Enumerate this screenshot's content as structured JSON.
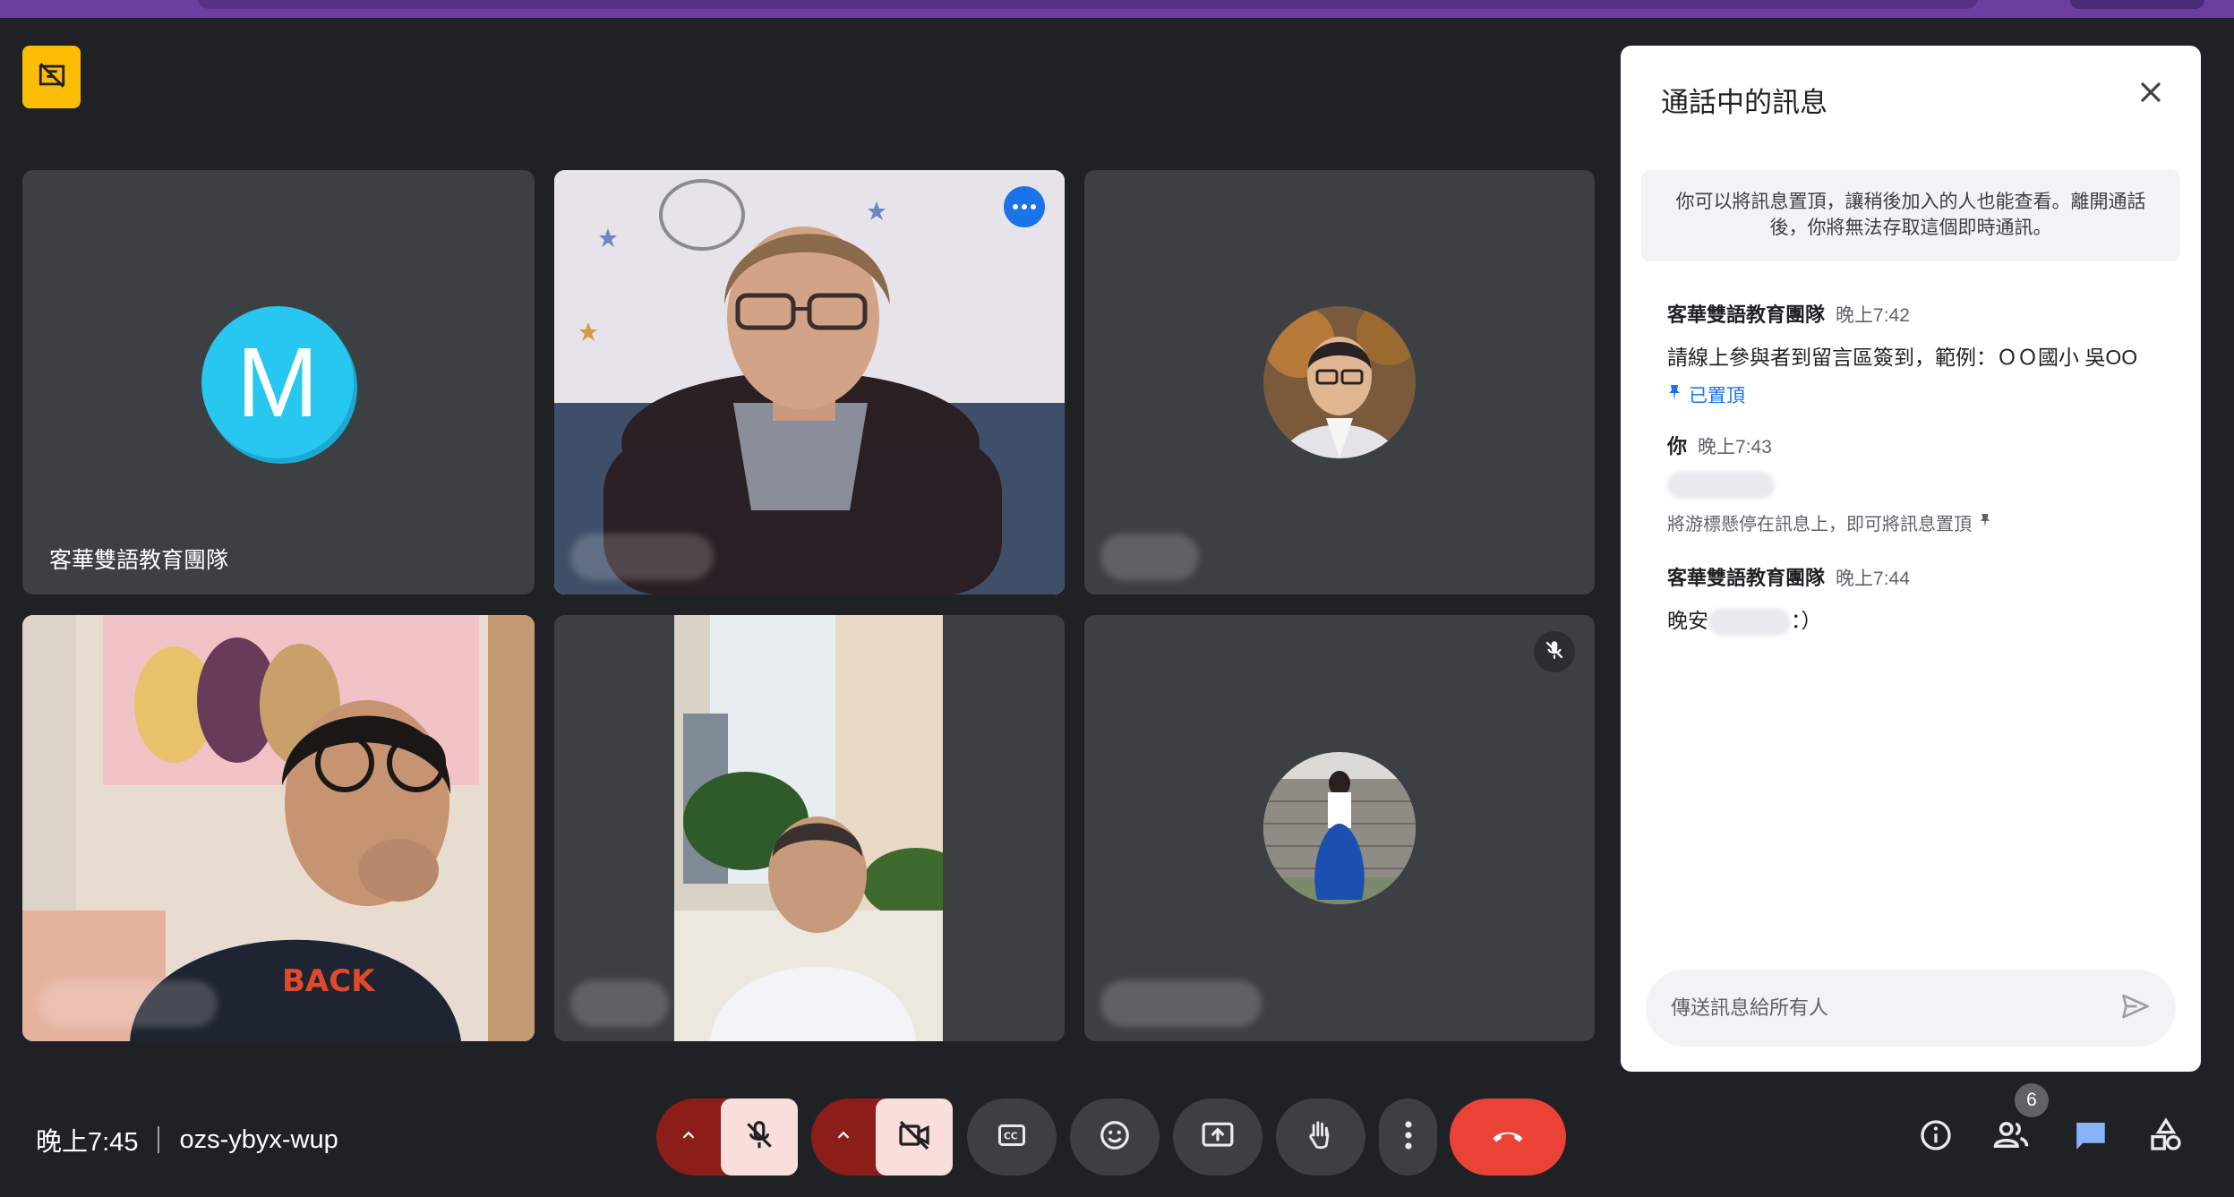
{
  "meeting": {
    "time": "晚上7:45",
    "code": "ozs-ybyx-wup",
    "participants_count": "6"
  },
  "tiles": [
    {
      "name": "客華雙語教育團隊",
      "avatar_letter": "M",
      "avatar_color": "#27c7f0"
    },
    {
      "name": "",
      "active": true
    },
    {
      "name": ""
    },
    {
      "name": ""
    },
    {
      "name": ""
    },
    {
      "name": "",
      "muted": true
    }
  ],
  "chat": {
    "title": "通話中的訊息",
    "notice": "你可以將訊息置頂，讓稍後加入的人也能查看。離開通話後，你將無法存取這個即時通訊。",
    "messages": [
      {
        "sender": "客華雙語教育團隊",
        "time": "晚上7:42",
        "text": "請線上參與者到留言區簽到，範例：ＯＯ國小 吳OO",
        "pinned_label": "已置頂"
      },
      {
        "sender": "你",
        "time": "晚上7:43",
        "hint": "將游標懸停在訊息上，即可將訊息置頂"
      },
      {
        "sender": "客華雙語教育團隊",
        "time": "晚上7:44",
        "text_prefix": "晚安",
        "text_suffix": "：）"
      }
    ],
    "input_placeholder": "傳送訊息給所有人"
  },
  "icons": {
    "recording": "no-recording-icon",
    "close": "close-icon",
    "send": "send-icon",
    "mic": "mic-off-icon",
    "camera": "camera-off-icon",
    "captions": "captions-icon",
    "emoji": "emoji-icon",
    "present": "present-icon",
    "hand": "raise-hand-icon",
    "more": "more-vert-icon",
    "end": "call-end-icon",
    "info": "info-icon",
    "people": "people-icon",
    "chat": "chat-icon",
    "activities": "activities-icon"
  },
  "colors": {
    "background": "#202124",
    "tile": "#3c4043",
    "accent": "#8ab4f8",
    "end_call": "#ea4335",
    "muted_control": "#8c1d18",
    "recording_badge": "#fbbc04"
  }
}
